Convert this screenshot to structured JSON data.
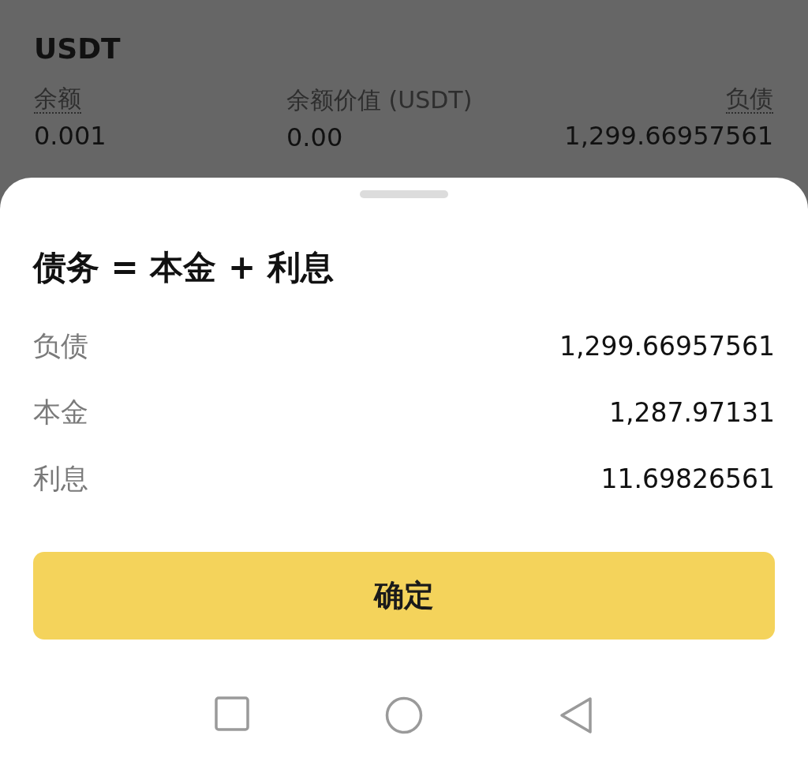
{
  "asset": {
    "symbol": "USDT",
    "stats": [
      {
        "label": "余额",
        "value": "0.001",
        "dotted_underline": true
      },
      {
        "label": "余额价值 (USDT)",
        "value": "0.00",
        "dotted_underline": false
      },
      {
        "label": "负债",
        "value": "1,299.66957561",
        "dotted_underline": true
      }
    ]
  },
  "sheet": {
    "title": "债务 = 本金 + 利息",
    "rows": [
      {
        "label": "负债",
        "value": "1,299.66957561"
      },
      {
        "label": "本金",
        "value": "1,287.97131"
      },
      {
        "label": "利息",
        "value": "11.69826561"
      }
    ],
    "confirm_button": "确定"
  },
  "nav_bar": [
    {
      "kind": "recents"
    },
    {
      "kind": "home"
    },
    {
      "kind": "back"
    }
  ]
}
